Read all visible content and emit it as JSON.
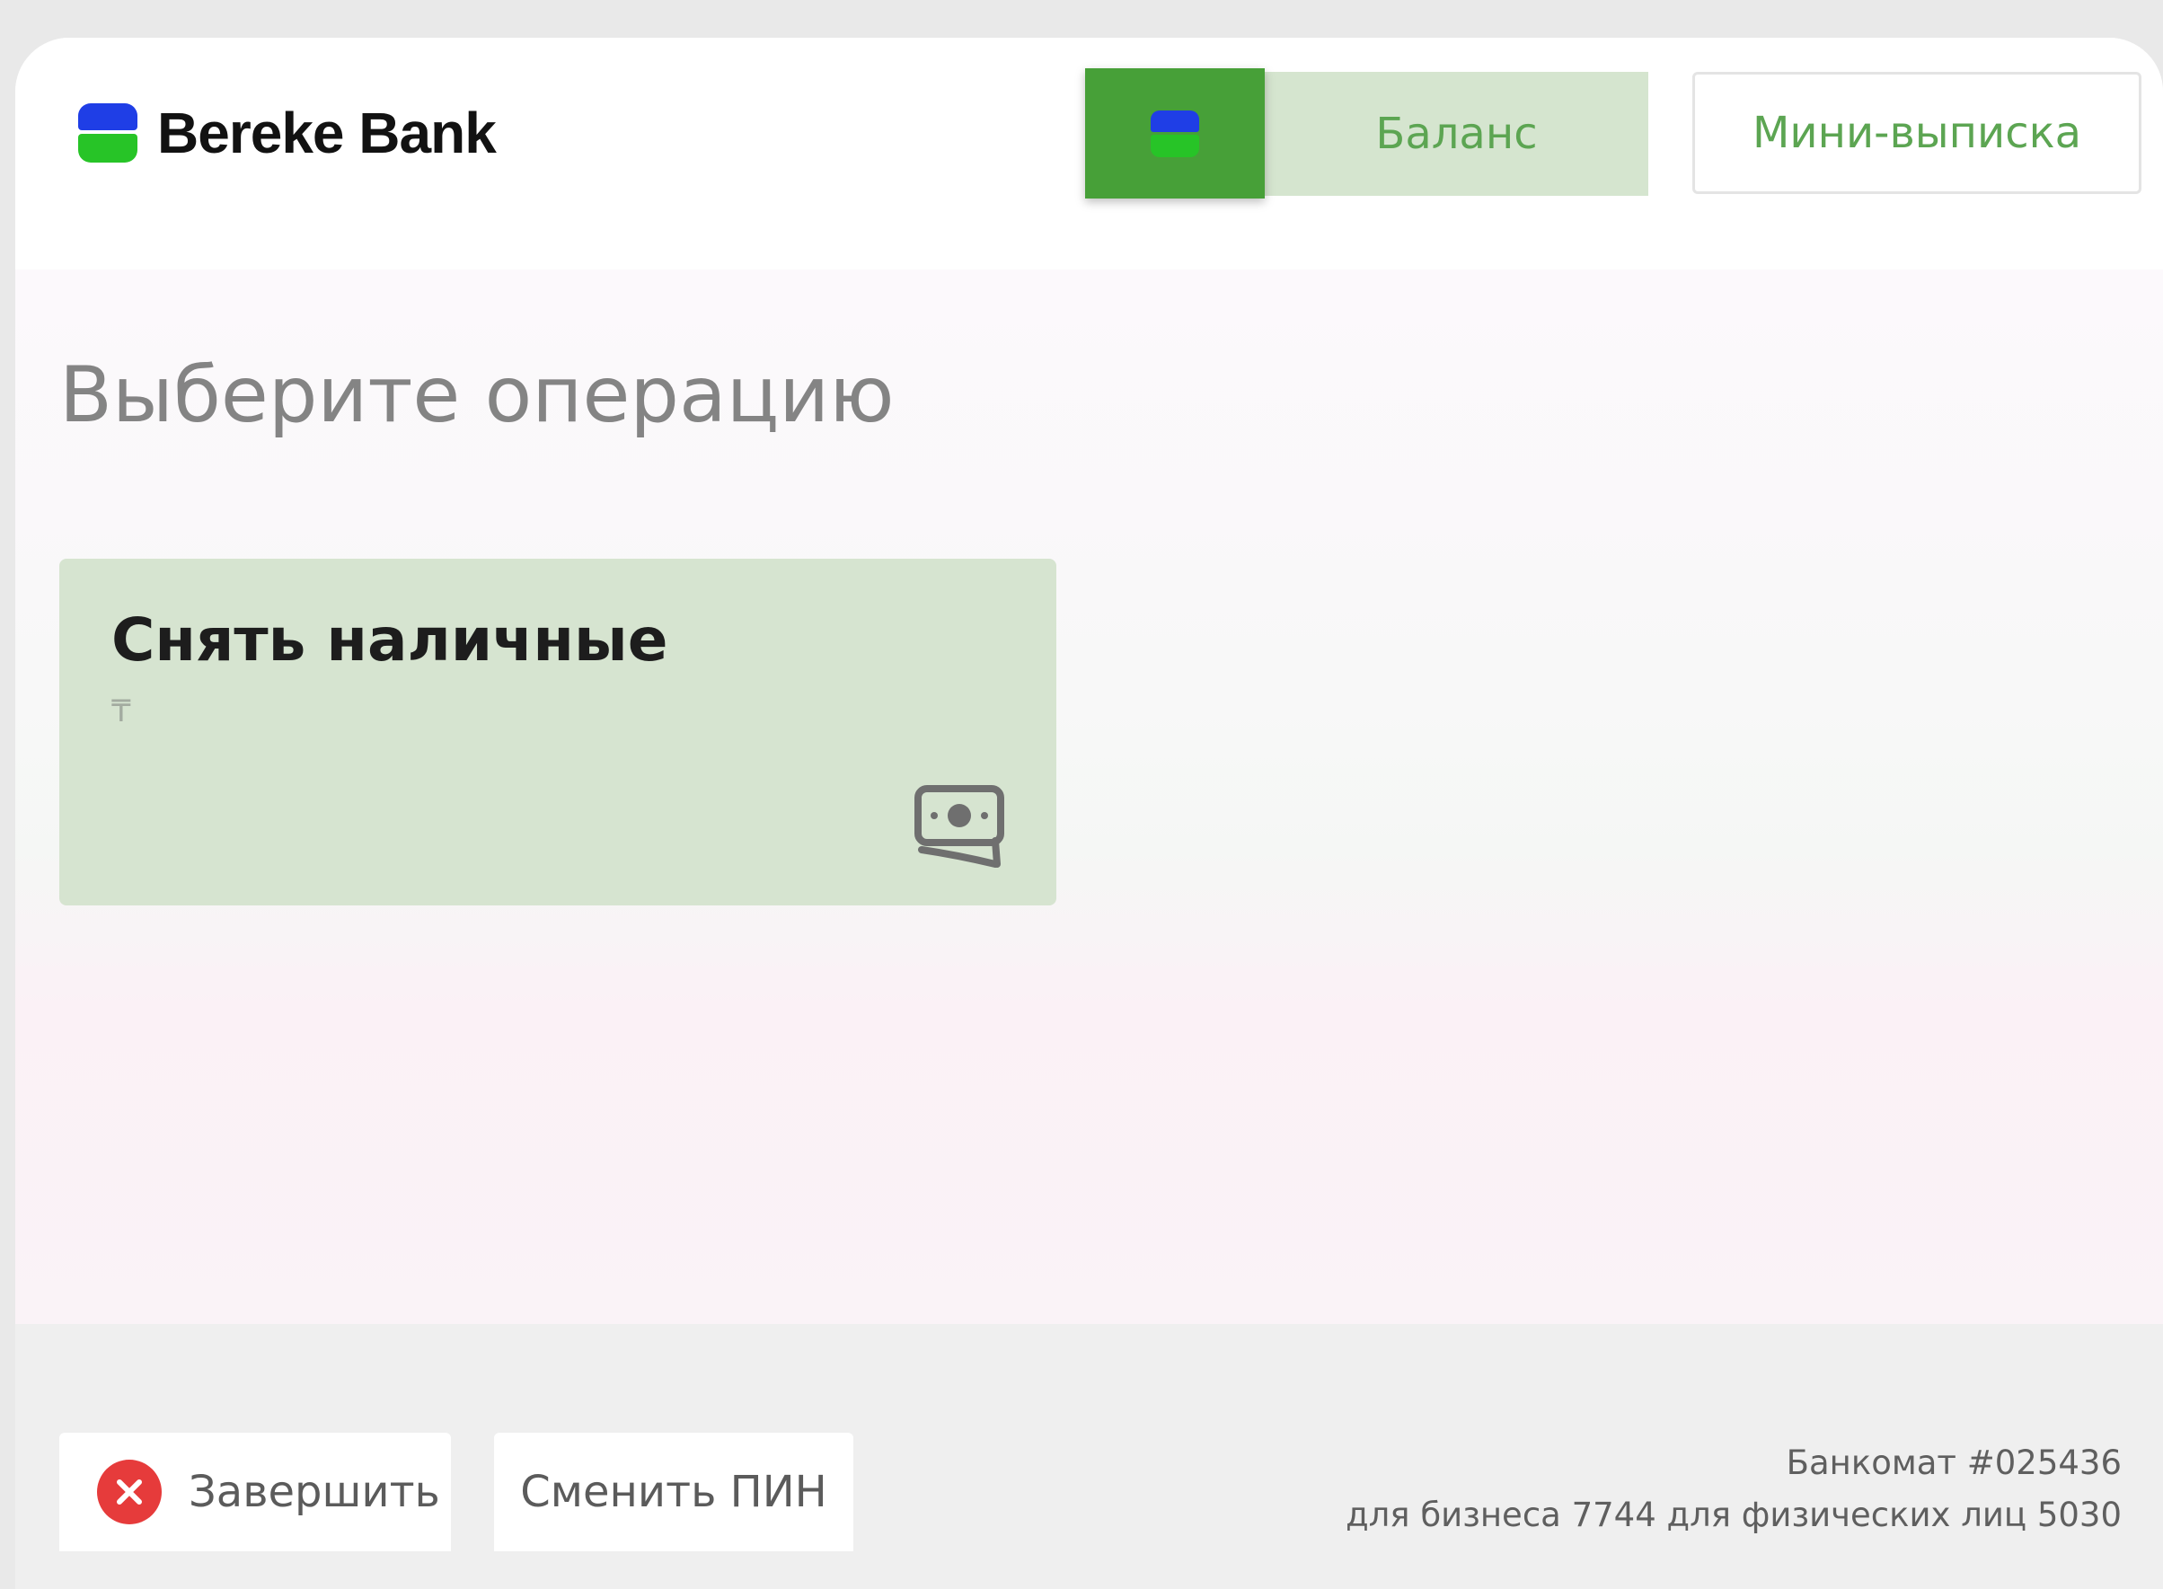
{
  "header": {
    "logo_text": "Bereke Bank",
    "balance_label": "Баланс",
    "mini_statement_label": "Мини-выписка"
  },
  "main": {
    "title": "Выберите операцию",
    "operations": [
      {
        "title": "Снять наличные",
        "subtitle": "₸",
        "icon": "cash-icon"
      }
    ]
  },
  "footer": {
    "finish_label": "Завершить",
    "finish_icon": "close-icon",
    "change_pin_label": "Сменить ПИН",
    "atm_number": "Банкомат #025436",
    "phones": "для бизнеса 7744 для физических лиц 5030"
  },
  "colors": {
    "brand_green": "#47a038",
    "brand_blue": "#1f3ee6",
    "accent_text": "#5ca552",
    "tile_bg": "#d6e4d0",
    "close_red": "#e63b3b"
  }
}
